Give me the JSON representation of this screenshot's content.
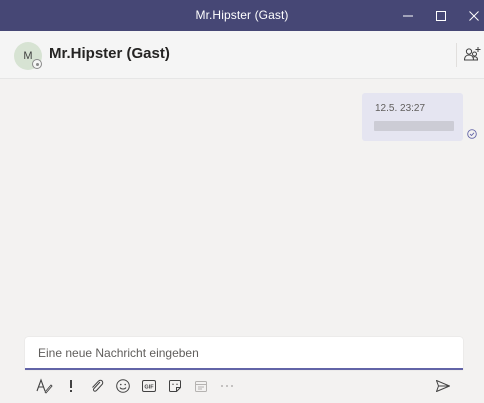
{
  "window": {
    "title": "Mr.Hipster (Gast)"
  },
  "header": {
    "avatar_initials": "M",
    "contact_name": "Mr.Hipster (Gast)"
  },
  "messages": [
    {
      "timestamp": "12.5. 23:27",
      "status": "read-check-icon"
    }
  ],
  "compose": {
    "placeholder": "Eine neue Nachricht eingeben",
    "value": ""
  },
  "toolbar": {
    "icons": [
      "format-icon",
      "important-icon",
      "attach-icon",
      "emoji-icon",
      "gif-icon",
      "sticker-icon",
      "schedule-meeting-icon",
      "more-options-icon",
      "send-icon"
    ],
    "gif_label": "GIF"
  },
  "colors": {
    "titlebar": "#464775",
    "accent": "#6264a7",
    "bubble": "#e5e5f1",
    "background": "#f3f2f1"
  }
}
